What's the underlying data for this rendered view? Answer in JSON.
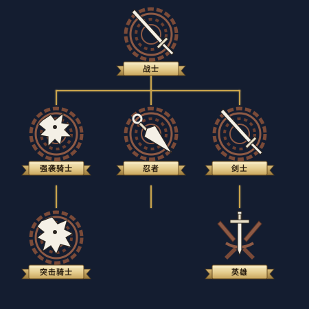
{
  "tree": {
    "root": {
      "label": "战士",
      "icon": "sword-icon"
    },
    "tier2": [
      {
        "label": "强袭骑士",
        "icon": "dragon-icon"
      },
      {
        "label": "忍者",
        "icon": "kunai-icon"
      },
      {
        "label": "剑士",
        "icon": "sword-icon"
      }
    ],
    "tier3": [
      {
        "label": "突击骑士",
        "icon": "dragon-icon"
      },
      {
        "label": "英雄",
        "icon": "crossed-swords-icon"
      }
    ]
  },
  "colors": {
    "background": "#141d30",
    "connector": "#c9a44c",
    "banner_face": "#ead7a2",
    "emblem_ring": "#8e5a45",
    "emblem_icon": "#f4f0e6"
  }
}
